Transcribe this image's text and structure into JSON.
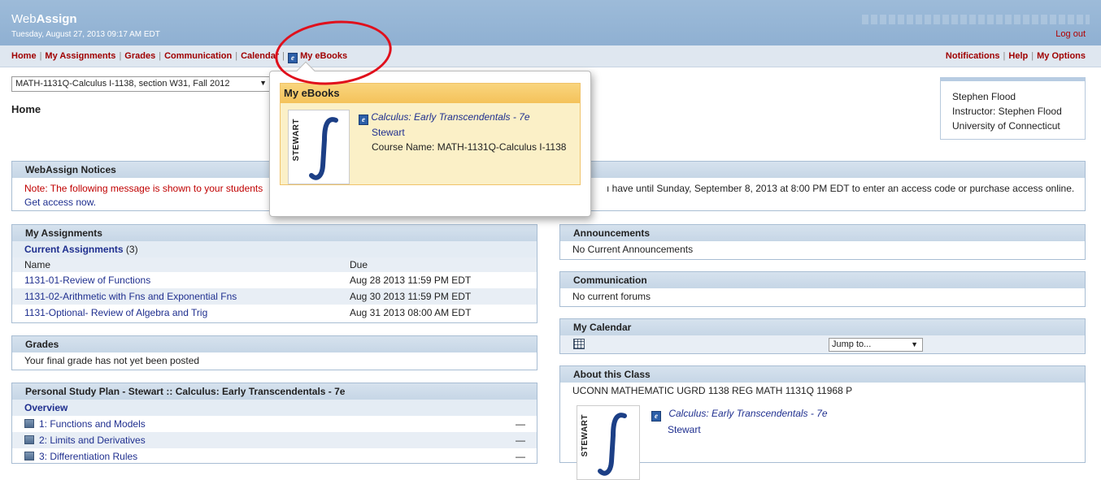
{
  "header": {
    "logo_light": "Web",
    "logo_bold": "Assign",
    "datetime": "Tuesday, August 27, 2013 09:17 AM EDT",
    "logout": "Log out"
  },
  "nav": {
    "left": [
      "Home",
      "My Assignments",
      "Grades",
      "Communication",
      "Calendar",
      "My eBooks"
    ],
    "right": [
      "Notifications",
      "Help",
      "My Options"
    ]
  },
  "course_select": "MATH-1131Q-Calculus I-1138, section W31, Fall 2012",
  "page_title": "Home",
  "user": {
    "name": "Stephen Flood",
    "instructor": "Instructor: Stephen Flood",
    "school": "University of Connecticut"
  },
  "notices": {
    "title": "WebAssign Notices",
    "message_red": "Note: The following message is shown to your students",
    "message_rest": "ı have until Sunday, September 8, 2013 at 8:00 PM EDT to enter an access code or purchase access online.",
    "link": "Get access now."
  },
  "assignments": {
    "title": "My Assignments",
    "current_label": "Current Assignments",
    "current_count": "(3)",
    "col_name": "Name",
    "col_due": "Due",
    "rows": [
      {
        "name": "1131-01-Review of Functions",
        "due": "Aug 28 2013 11:59 PM EDT"
      },
      {
        "name": "1131-02-Arithmetic with Fns and Exponential Fns",
        "due": "Aug 30 2013 11:59 PM EDT"
      },
      {
        "name": "1131-Optional- Review of Algebra and Trig",
        "due": "Aug 31 2013 08:00 AM EDT"
      }
    ]
  },
  "grades": {
    "title": "Grades",
    "text": "Your final grade has not yet been posted"
  },
  "study_plan": {
    "title": "Personal Study Plan - Stewart :: Calculus: Early Transcendentals - 7e",
    "overview": "Overview",
    "chapters": [
      {
        "label": "1: Functions and Models",
        "status": "—"
      },
      {
        "label": "2: Limits and Derivatives",
        "status": "—"
      },
      {
        "label": "3: Differentiation Rules",
        "status": "—"
      }
    ]
  },
  "announcements": {
    "title": "Announcements",
    "text": "No Current Announcements"
  },
  "communication": {
    "title": "Communication",
    "text": "No current forums"
  },
  "calendar": {
    "title": "My Calendar",
    "jump": "Jump to..."
  },
  "about": {
    "title": "About this Class",
    "course_code": "UCONN MATHEMATIC UGRD 1138 REG MATH 1131Q 11968 P",
    "book_title": "Calculus: Early Transcendentals - 7e",
    "book_author": "Stewart",
    "cover_author": "STEWART"
  },
  "ebook_popup": {
    "title": "My eBooks",
    "book_title": "Calculus: Early Transcendentals - 7e",
    "book_author": "Stewart",
    "course_name": "Course Name: MATH-1131Q-Calculus I-1138",
    "cover_author": "STEWART"
  },
  "colors": {
    "header": "#9dbbd9",
    "nav_link": "#a00000",
    "link": "#1f2f8f",
    "notice_red": "#c00000",
    "annotation": "#e0101c"
  }
}
